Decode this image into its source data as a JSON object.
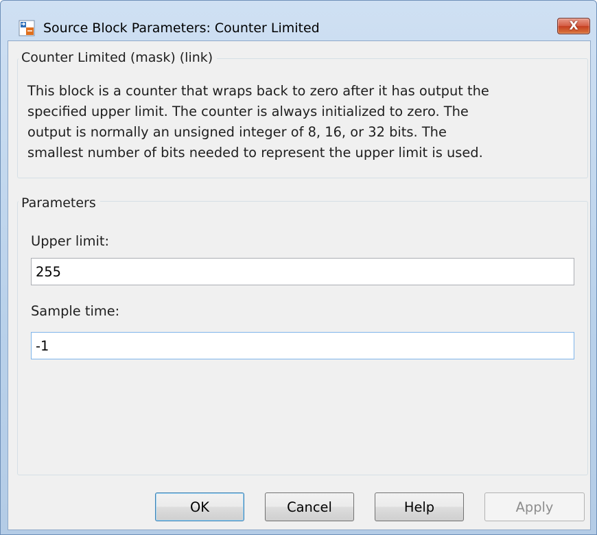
{
  "window": {
    "title": "Source Block Parameters: Counter Limited",
    "close_glyph": "X"
  },
  "description": {
    "legend": "Counter Limited (mask) (link)",
    "lines": [
      "This block is a counter that wraps back to zero after it has output the",
      "specified upper limit.  The counter is always initialized to zero.  The",
      "output is normally an unsigned integer of 8, 16, or 32 bits.  The",
      "smallest number of bits needed to represent the upper limit is used."
    ]
  },
  "parameters": {
    "legend": "Parameters",
    "upper_limit": {
      "label": "Upper limit:",
      "value": "255"
    },
    "sample_time": {
      "label": "Sample time:",
      "value": "-1"
    }
  },
  "buttons": {
    "ok": "OK",
    "cancel": "Cancel",
    "help": "Help",
    "apply": "Apply"
  },
  "icons": {
    "app": "simulink-block-icon",
    "close": "close-icon"
  },
  "colors": {
    "titlebar": "#b9d1ea",
    "close_button": "#c53f22",
    "client_background": "#f0f0f0",
    "default_button_border": "#3c7fb1",
    "disabled_text": "#8d8d8d"
  }
}
